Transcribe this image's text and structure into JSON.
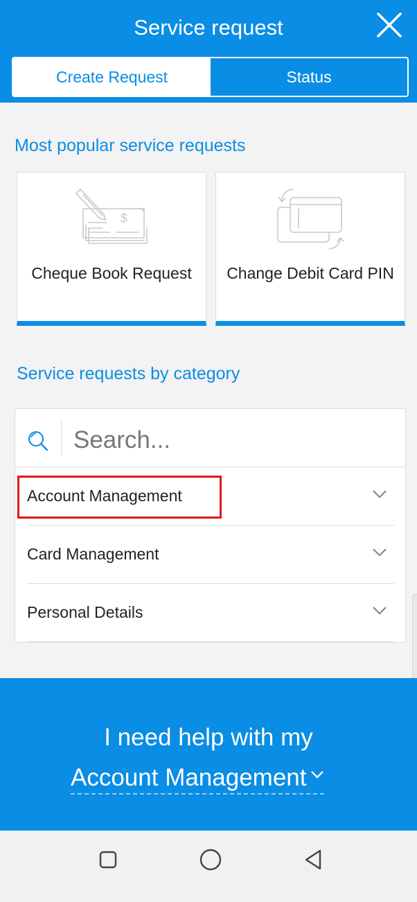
{
  "header": {
    "title": "Service request",
    "close_icon": "close-icon"
  },
  "tabs": [
    {
      "label": "Create Request",
      "active": true
    },
    {
      "label": "Status",
      "active": false
    }
  ],
  "popular": {
    "title": "Most popular service requests",
    "cards": [
      {
        "label": "Cheque Book Request",
        "icon": "cheque-book-icon"
      },
      {
        "label": "Change Debit Card PIN",
        "icon": "debit-card-swap-icon"
      }
    ]
  },
  "category": {
    "title": "Service requests by category",
    "search_placeholder": "Search...",
    "items": [
      {
        "label": "Account Management"
      },
      {
        "label": "Card Management"
      },
      {
        "label": "Personal Details"
      }
    ]
  },
  "help": {
    "line1": "I need help with my",
    "selected": "Account Management"
  },
  "colors": {
    "brand": "#0a8de4",
    "highlight": "#e0161c",
    "background": "#f3f3f3"
  },
  "system_nav": [
    "recent-apps-icon",
    "home-icon",
    "back-icon"
  ]
}
